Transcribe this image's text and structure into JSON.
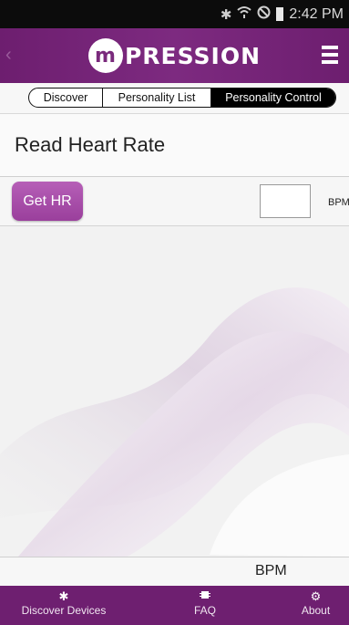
{
  "status_bar": {
    "time": "2:42 PM",
    "icons": [
      "bluetooth-icon",
      "wifi-icon",
      "no-signal-icon",
      "battery-icon"
    ]
  },
  "app_bar": {
    "logo_mark": "m",
    "logo_text": "PRESSION",
    "back_icon": "chevron-left-icon",
    "menu_icon": "hamburger-menu-icon"
  },
  "tabs": [
    {
      "label": "Discover"
    },
    {
      "label": "Personality List"
    },
    {
      "label": "Personality Control",
      "selected": true
    }
  ],
  "page": {
    "title": "Read Heart Rate"
  },
  "heart_rate": {
    "button_label": "Get HR",
    "value": "",
    "unit_label": "BPM"
  },
  "footer_readout": {
    "unit_label": "BPM"
  },
  "bottom_nav": [
    {
      "label": "Discover Devices",
      "icon": "bluetooth-icon"
    },
    {
      "label": "FAQ",
      "icon": "chip-icon"
    },
    {
      "label": "About",
      "icon": "gear-icon"
    }
  ],
  "colors": {
    "brand_purple": "#6e1f70",
    "button_purple": "#a44aa6",
    "status_bar": "#0c0c0c"
  }
}
